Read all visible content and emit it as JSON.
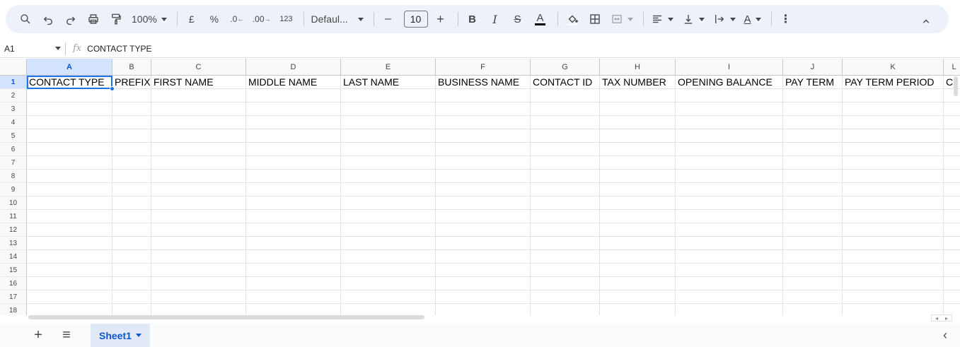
{
  "toolbar": {
    "zoom": "100%",
    "currency_symbol": "£",
    "percent_symbol": "%",
    "decrease_decimal": ".0",
    "increase_decimal": ".00",
    "number_format": "123",
    "font_name": "Defaul...",
    "font_size": "10",
    "minus": "–",
    "plus": "+",
    "bold": "B",
    "italic": "I",
    "strike": "S",
    "text_color": "A",
    "text_rotate": "A"
  },
  "formula_bar": {
    "name_box": "A1",
    "fx": "fx",
    "content": "CONTACT TYPE"
  },
  "columns": [
    {
      "letter": "A",
      "selected": true
    },
    {
      "letter": "B"
    },
    {
      "letter": "C"
    },
    {
      "letter": "D"
    },
    {
      "letter": "E"
    },
    {
      "letter": "F"
    },
    {
      "letter": "G"
    },
    {
      "letter": "H"
    },
    {
      "letter": "I"
    },
    {
      "letter": "J"
    },
    {
      "letter": "K"
    },
    {
      "letter": "L"
    }
  ],
  "rows": [
    "1",
    "2",
    "3",
    "4",
    "5",
    "6",
    "7",
    "8",
    "9",
    "10",
    "11",
    "12",
    "13",
    "14",
    "15",
    "16",
    "17",
    "18"
  ],
  "header_cells": [
    "CONTACT TYPE",
    "PREFIX",
    "FIRST NAME",
    "MIDDLE NAME",
    "LAST NAME",
    "BUSINESS NAME",
    "CONTACT ID",
    "TAX NUMBER",
    "OPENING BALANCE",
    "PAY TERM",
    "PAY TERM PERIOD",
    "C"
  ],
  "sheets": [
    {
      "name": "Sheet1",
      "active": true
    }
  ],
  "colors": {
    "accent": "#1a73e8",
    "toolbar_bg": "#edf2fa",
    "selected_header": "#d3e3fd"
  }
}
